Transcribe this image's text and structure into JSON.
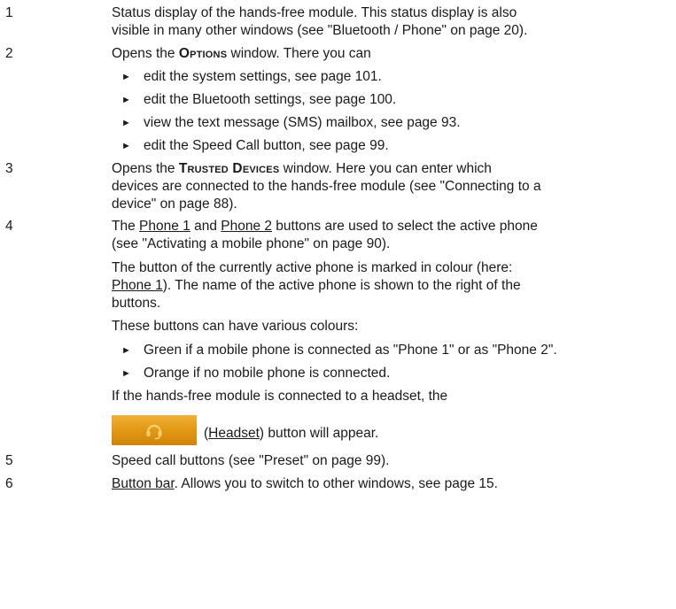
{
  "items": [
    {
      "num": "1",
      "line1": "Status display of the hands-free module. This status display is also",
      "line2": "visible in many other windows (see \"Bluetooth / Phone\" on page 20)."
    },
    {
      "num": "2",
      "intro_pre": "Opens the ",
      "intro_window": "Options",
      "intro_post": " window. There you can",
      "bullets": [
        "edit the system settings, see page 101.",
        "edit the Bluetooth settings, see page 100.",
        "view the text message (SMS) mailbox, see page 93.",
        "edit the Speed Call button, see page 99."
      ]
    },
    {
      "num": "3",
      "line1_pre": "Opens the ",
      "line1_window": "Trusted Devices",
      "line1_post": " window. Here you can enter which",
      "line2": "devices are connected to the hands-free module (see \"Connecting to a",
      "line3": "device\" on page 88)."
    },
    {
      "num": "4",
      "l1_a": "The ",
      "l1_b": "Phone 1",
      "l1_c": " and ",
      "l1_d": "Phone 2",
      "l1_e": " buttons are used to select the active phone",
      "l2": "(see \"Activating a mobile phone\" on page 90).",
      "p2_l1": "The button of the currently active phone is marked in colour (here:",
      "p2_l2_a": "Phone 1",
      "p2_l2_b": "). The name of the active phone is shown to the right of the",
      "p2_l3": "buttons.",
      "p3": "These buttons can have various colours:",
      "bullets": [
        "Green if a mobile phone is connected as \"Phone 1\" or as \"Phone 2\".",
        "Orange if no mobile phone is connected."
      ],
      "p4": "If the hands-free module is connected to a headset, the",
      "headset_paren_open": "(",
      "headset_label": "Headset",
      "headset_tail": ") button will appear.",
      "headset_button_color": "#e49a16",
      "headset_icon": "headset-icon"
    },
    {
      "num": "5",
      "text": "Speed call buttons (see \"Preset\" on page 99)."
    },
    {
      "num": "6",
      "text_a": "Button bar",
      "text_b": ". Allows you to switch to other windows, see page 15."
    }
  ]
}
